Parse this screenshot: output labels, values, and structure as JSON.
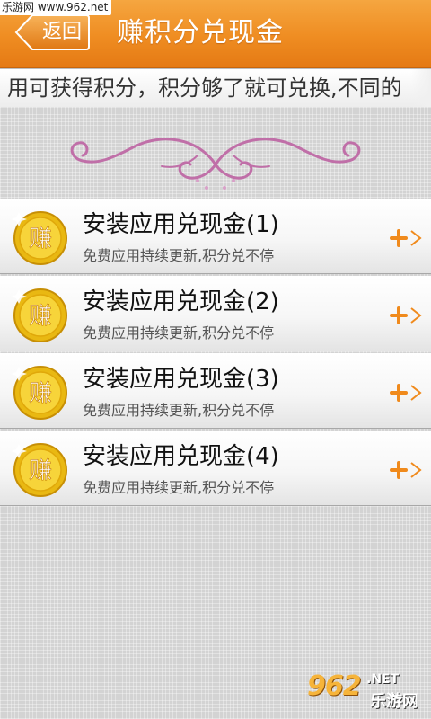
{
  "watermark_top": "乐游网 www.962.net",
  "header": {
    "back_label": "返回",
    "title": "赚积分兑现金"
  },
  "marquee": {
    "text": "用可获得积分，积分够了就可兑换,不同的"
  },
  "list": {
    "coin_char": "赚",
    "items": [
      {
        "title": "安装应用兑现金(1)",
        "subtitle": "免费应用持续更新,积分兑不停"
      },
      {
        "title": "安装应用兑现金(2)",
        "subtitle": "免费应用持续更新,积分兑不停"
      },
      {
        "title": "安装应用兑现金(3)",
        "subtitle": "免费应用持续更新,积分兑不停"
      },
      {
        "title": "安装应用兑现金(4)",
        "subtitle": "免费应用持续更新,积分兑不停"
      }
    ]
  },
  "logo": {
    "big": "962",
    "net": ".NET",
    "cn": "乐游网"
  },
  "colors": {
    "header_orange": "#ef8d22",
    "coin_gold": "#f3c51a",
    "plus_orange": "#f08a1c",
    "ornament_pink": "#c06fa8"
  },
  "icons": {
    "back": "back-arrow-button",
    "coin": "gold-coin-icon",
    "action": "plus-chevron-icon",
    "ornament": "decorative-scroll"
  }
}
